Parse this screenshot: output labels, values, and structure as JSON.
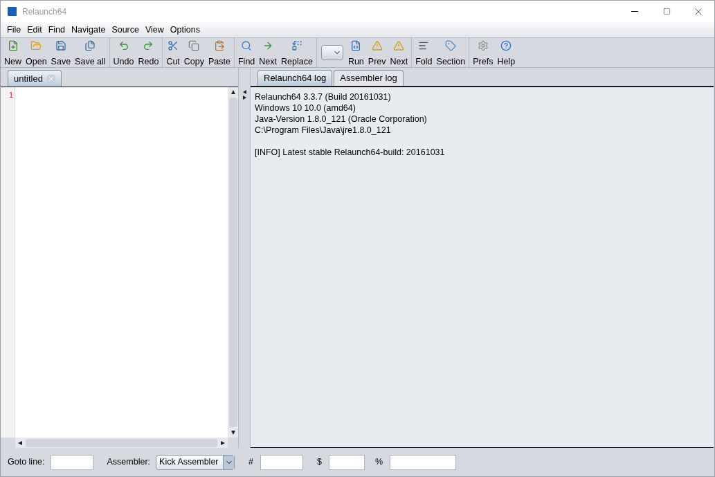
{
  "window": {
    "title": "Relaunch64"
  },
  "menu": [
    "File",
    "Edit",
    "Find",
    "Navigate",
    "Source",
    "View",
    "Options"
  ],
  "toolbar": [
    [
      {
        "kind": "button",
        "label": "New"
      },
      {
        "kind": "button",
        "label": "Open"
      },
      {
        "kind": "button",
        "label": "Save"
      },
      {
        "kind": "button",
        "label": "Save all"
      }
    ],
    [
      {
        "kind": "button",
        "label": "Undo"
      },
      {
        "kind": "button",
        "label": "Redo"
      }
    ],
    [
      {
        "kind": "button",
        "label": "Cut"
      },
      {
        "kind": "button",
        "label": "Copy"
      },
      {
        "kind": "button",
        "label": "Paste"
      }
    ],
    [
      {
        "kind": "button",
        "label": "Find"
      },
      {
        "kind": "button",
        "label": "Next"
      },
      {
        "kind": "button",
        "label": "Replace"
      }
    ],
    [
      {
        "kind": "combo"
      },
      {
        "kind": "button",
        "label": "Run"
      },
      {
        "kind": "button",
        "label": "Prev"
      },
      {
        "kind": "button",
        "label": "Next"
      }
    ],
    [
      {
        "kind": "button",
        "label": "Fold"
      },
      {
        "kind": "button",
        "label": "Section"
      }
    ],
    [
      {
        "kind": "button",
        "label": "Prefs"
      },
      {
        "kind": "button",
        "label": "Help"
      }
    ]
  ],
  "editor_tabs": [
    {
      "label": "untitled",
      "selected": true
    }
  ],
  "editor": {
    "line_numbers": [
      "1"
    ]
  },
  "log_tabs": [
    {
      "label": "Relaunch64 log",
      "selected": true
    },
    {
      "label": "Assembler log",
      "selected": false
    }
  ],
  "log_blocks": [
    [
      "Relaunch64 3.3.7 (Build 20161031)",
      "Windows 10 10.0 (amd64)",
      "Java-Version 1.8.0_121 (Oracle Corporation)",
      "C:\\Program Files\\Java\\jre1.8.0_121"
    ],
    [
      "[INFO] Latest stable Relaunch64-build: 20161031"
    ]
  ],
  "status_bar": {
    "goto_label": "Goto line:",
    "assembler_label": "Assembler:",
    "assembler_value": "Kick Assembler",
    "hash_label": "#",
    "dollar_label": "$",
    "percent_label": "%"
  }
}
